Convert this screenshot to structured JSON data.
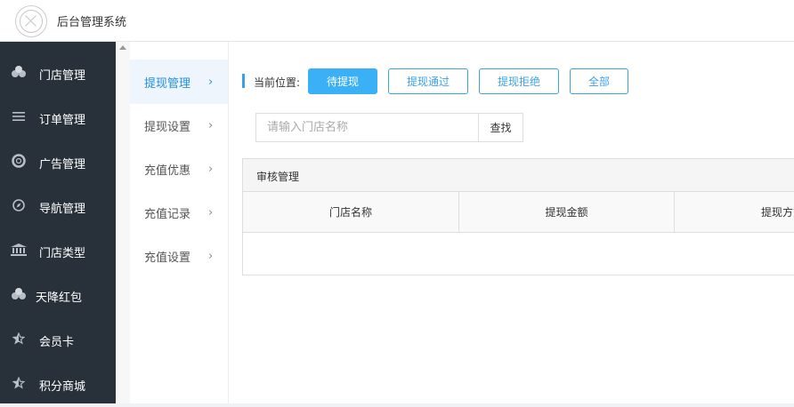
{
  "app": {
    "title": "后台管理系统"
  },
  "sidebar": {
    "items": [
      {
        "label": "门店管理",
        "icon": "cubes-icon"
      },
      {
        "label": "订单管理",
        "icon": "list-icon"
      },
      {
        "label": "广告管理",
        "icon": "lifebuoy-icon"
      },
      {
        "label": "导航管理",
        "icon": "compass-icon"
      },
      {
        "label": "门店类型",
        "icon": "bank-icon"
      },
      {
        "label": "天降红包",
        "icon": "cubes-icon"
      },
      {
        "label": "会员卡",
        "icon": "star-half-icon"
      },
      {
        "label": "积分商城",
        "icon": "star-half-icon"
      }
    ]
  },
  "submenu": {
    "items": [
      {
        "label": "提现管理",
        "active": true
      },
      {
        "label": "提现设置"
      },
      {
        "label": "充值优惠"
      },
      {
        "label": "充值记录"
      },
      {
        "label": "充值设置"
      }
    ]
  },
  "main": {
    "location_label": "当前位置:",
    "tabs": [
      {
        "label": "待提现",
        "active": true
      },
      {
        "label": "提现通过"
      },
      {
        "label": "提现拒绝"
      },
      {
        "label": "全部"
      }
    ],
    "search": {
      "placeholder": "请输入门店名称",
      "value": "",
      "button_label": "查找"
    },
    "panel": {
      "title": "审核管理",
      "columns": [
        "门店名称",
        "提现金额",
        "提现方式"
      ]
    }
  },
  "colors": {
    "sidebar_bg": "#28313a",
    "accent": "#3ab0f6",
    "accent_border": "#3aa0e8"
  }
}
